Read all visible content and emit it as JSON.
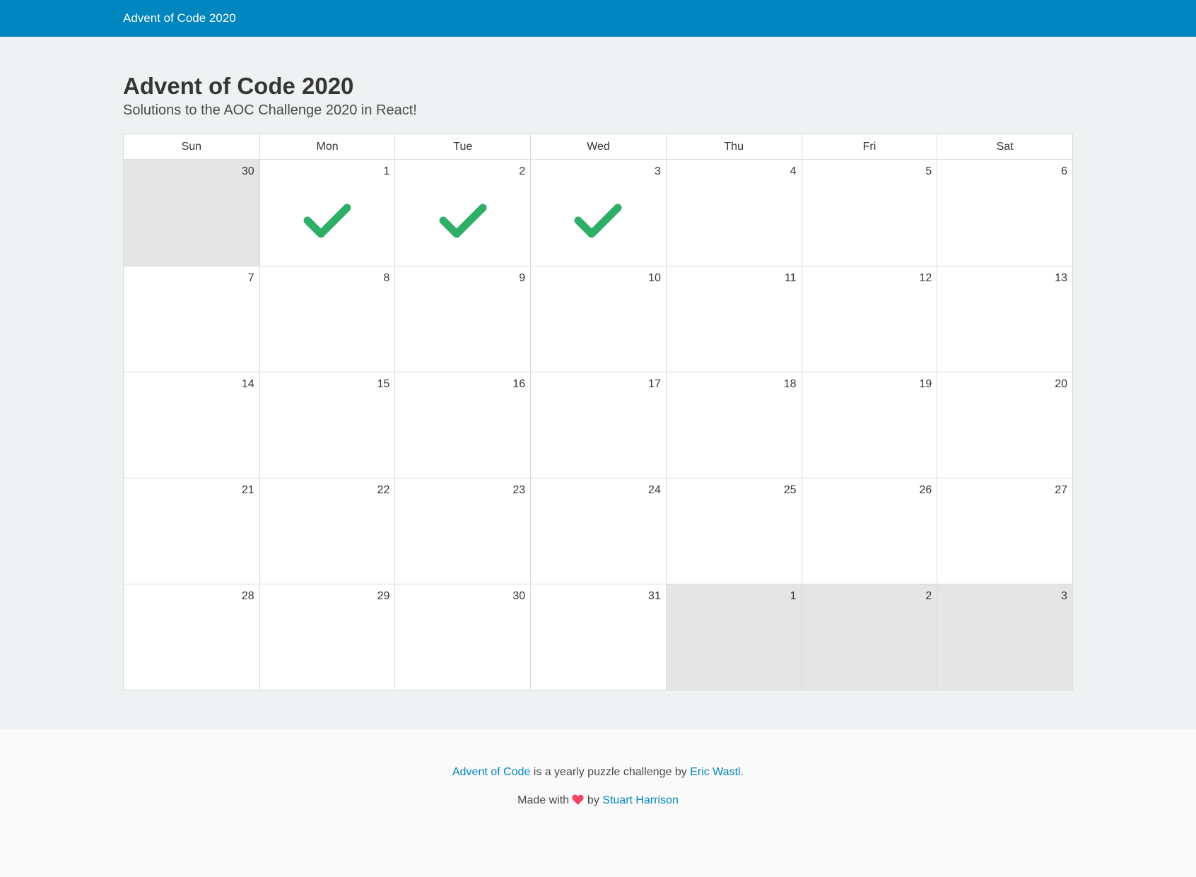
{
  "header": {
    "brand": "Advent of Code 2020",
    "background_color": "#0086bf"
  },
  "main": {
    "title": "Advent of Code 2020",
    "subtitle": "Solutions to the AOC Challenge 2020 in React!"
  },
  "calendar": {
    "weekdays": [
      "Sun",
      "Mon",
      "Tue",
      "Wed",
      "Thu",
      "Fri",
      "Sat"
    ],
    "days": [
      {
        "label": "30",
        "other_month": true,
        "completed": false
      },
      {
        "label": "1",
        "other_month": false,
        "completed": true
      },
      {
        "label": "2",
        "other_month": false,
        "completed": true
      },
      {
        "label": "3",
        "other_month": false,
        "completed": true
      },
      {
        "label": "4",
        "other_month": false,
        "completed": false
      },
      {
        "label": "5",
        "other_month": false,
        "completed": false
      },
      {
        "label": "6",
        "other_month": false,
        "completed": false
      },
      {
        "label": "7",
        "other_month": false,
        "completed": false
      },
      {
        "label": "8",
        "other_month": false,
        "completed": false
      },
      {
        "label": "9",
        "other_month": false,
        "completed": false
      },
      {
        "label": "10",
        "other_month": false,
        "completed": false
      },
      {
        "label": "11",
        "other_month": false,
        "completed": false
      },
      {
        "label": "12",
        "other_month": false,
        "completed": false
      },
      {
        "label": "13",
        "other_month": false,
        "completed": false
      },
      {
        "label": "14",
        "other_month": false,
        "completed": false
      },
      {
        "label": "15",
        "other_month": false,
        "completed": false
      },
      {
        "label": "16",
        "other_month": false,
        "completed": false
      },
      {
        "label": "17",
        "other_month": false,
        "completed": false
      },
      {
        "label": "18",
        "other_month": false,
        "completed": false
      },
      {
        "label": "19",
        "other_month": false,
        "completed": false
      },
      {
        "label": "20",
        "other_month": false,
        "completed": false
      },
      {
        "label": "21",
        "other_month": false,
        "completed": false
      },
      {
        "label": "22",
        "other_month": false,
        "completed": false
      },
      {
        "label": "23",
        "other_month": false,
        "completed": false
      },
      {
        "label": "24",
        "other_month": false,
        "completed": false
      },
      {
        "label": "25",
        "other_month": false,
        "completed": false
      },
      {
        "label": "26",
        "other_month": false,
        "completed": false
      },
      {
        "label": "27",
        "other_month": false,
        "completed": false
      },
      {
        "label": "28",
        "other_month": false,
        "completed": false
      },
      {
        "label": "29",
        "other_month": false,
        "completed": false
      },
      {
        "label": "30",
        "other_month": false,
        "completed": false
      },
      {
        "label": "31",
        "other_month": false,
        "completed": false
      },
      {
        "label": "1",
        "other_month": true,
        "completed": false
      },
      {
        "label": "2",
        "other_month": true,
        "completed": false
      },
      {
        "label": "3",
        "other_month": true,
        "completed": false
      }
    ],
    "check_icon": "check-icon",
    "check_color": "#2eae66",
    "other_month_color": "#e5e5e5"
  },
  "footer": {
    "line1": {
      "link1": "Advent of Code",
      "text": " is a yearly puzzle challenge by ",
      "link2": "Eric Wastl",
      "end": "."
    },
    "line2": {
      "text1": "Made with ",
      "heart_icon": "heart-icon",
      "heart_color": "#f14668",
      "text2": " by ",
      "link": "Stuart Harrison"
    },
    "link_color": "#0086bf"
  }
}
